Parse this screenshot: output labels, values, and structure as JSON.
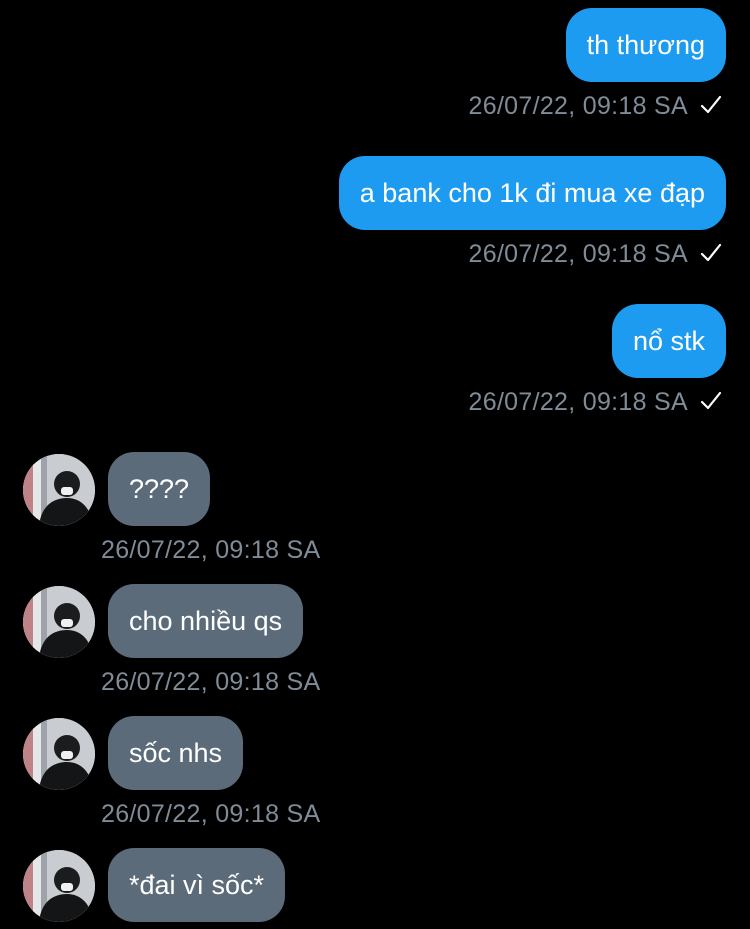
{
  "messages": [
    {
      "direction": "out",
      "text": "th thương",
      "timestamp": "26/07/22, 09:18 SA",
      "read": true
    },
    {
      "direction": "out",
      "text": "a bank cho 1k đi mua xe đạp",
      "timestamp": "26/07/22, 09:18 SA",
      "read": true
    },
    {
      "direction": "out",
      "text": "nổ stk",
      "timestamp": "26/07/22, 09:18 SA",
      "read": true
    },
    {
      "direction": "in",
      "text": "????",
      "timestamp": "26/07/22, 09:18 SA"
    },
    {
      "direction": "in",
      "text": "cho nhiều qs",
      "timestamp": "26/07/22, 09:18 SA"
    },
    {
      "direction": "in",
      "text": "sốc nhs",
      "timestamp": "26/07/22, 09:18 SA"
    },
    {
      "direction": "in",
      "text": "*đai vì sốc*"
    }
  ],
  "icons": {
    "read_receipt": "checkmark-icon",
    "contact_avatar": "avatar"
  },
  "colors": {
    "background": "#000000",
    "outgoing_bubble": "#1d9bf0",
    "incoming_bubble": "#5c6b7a",
    "timestamp_text": "#7f8c98",
    "message_text": "#ffffff"
  }
}
